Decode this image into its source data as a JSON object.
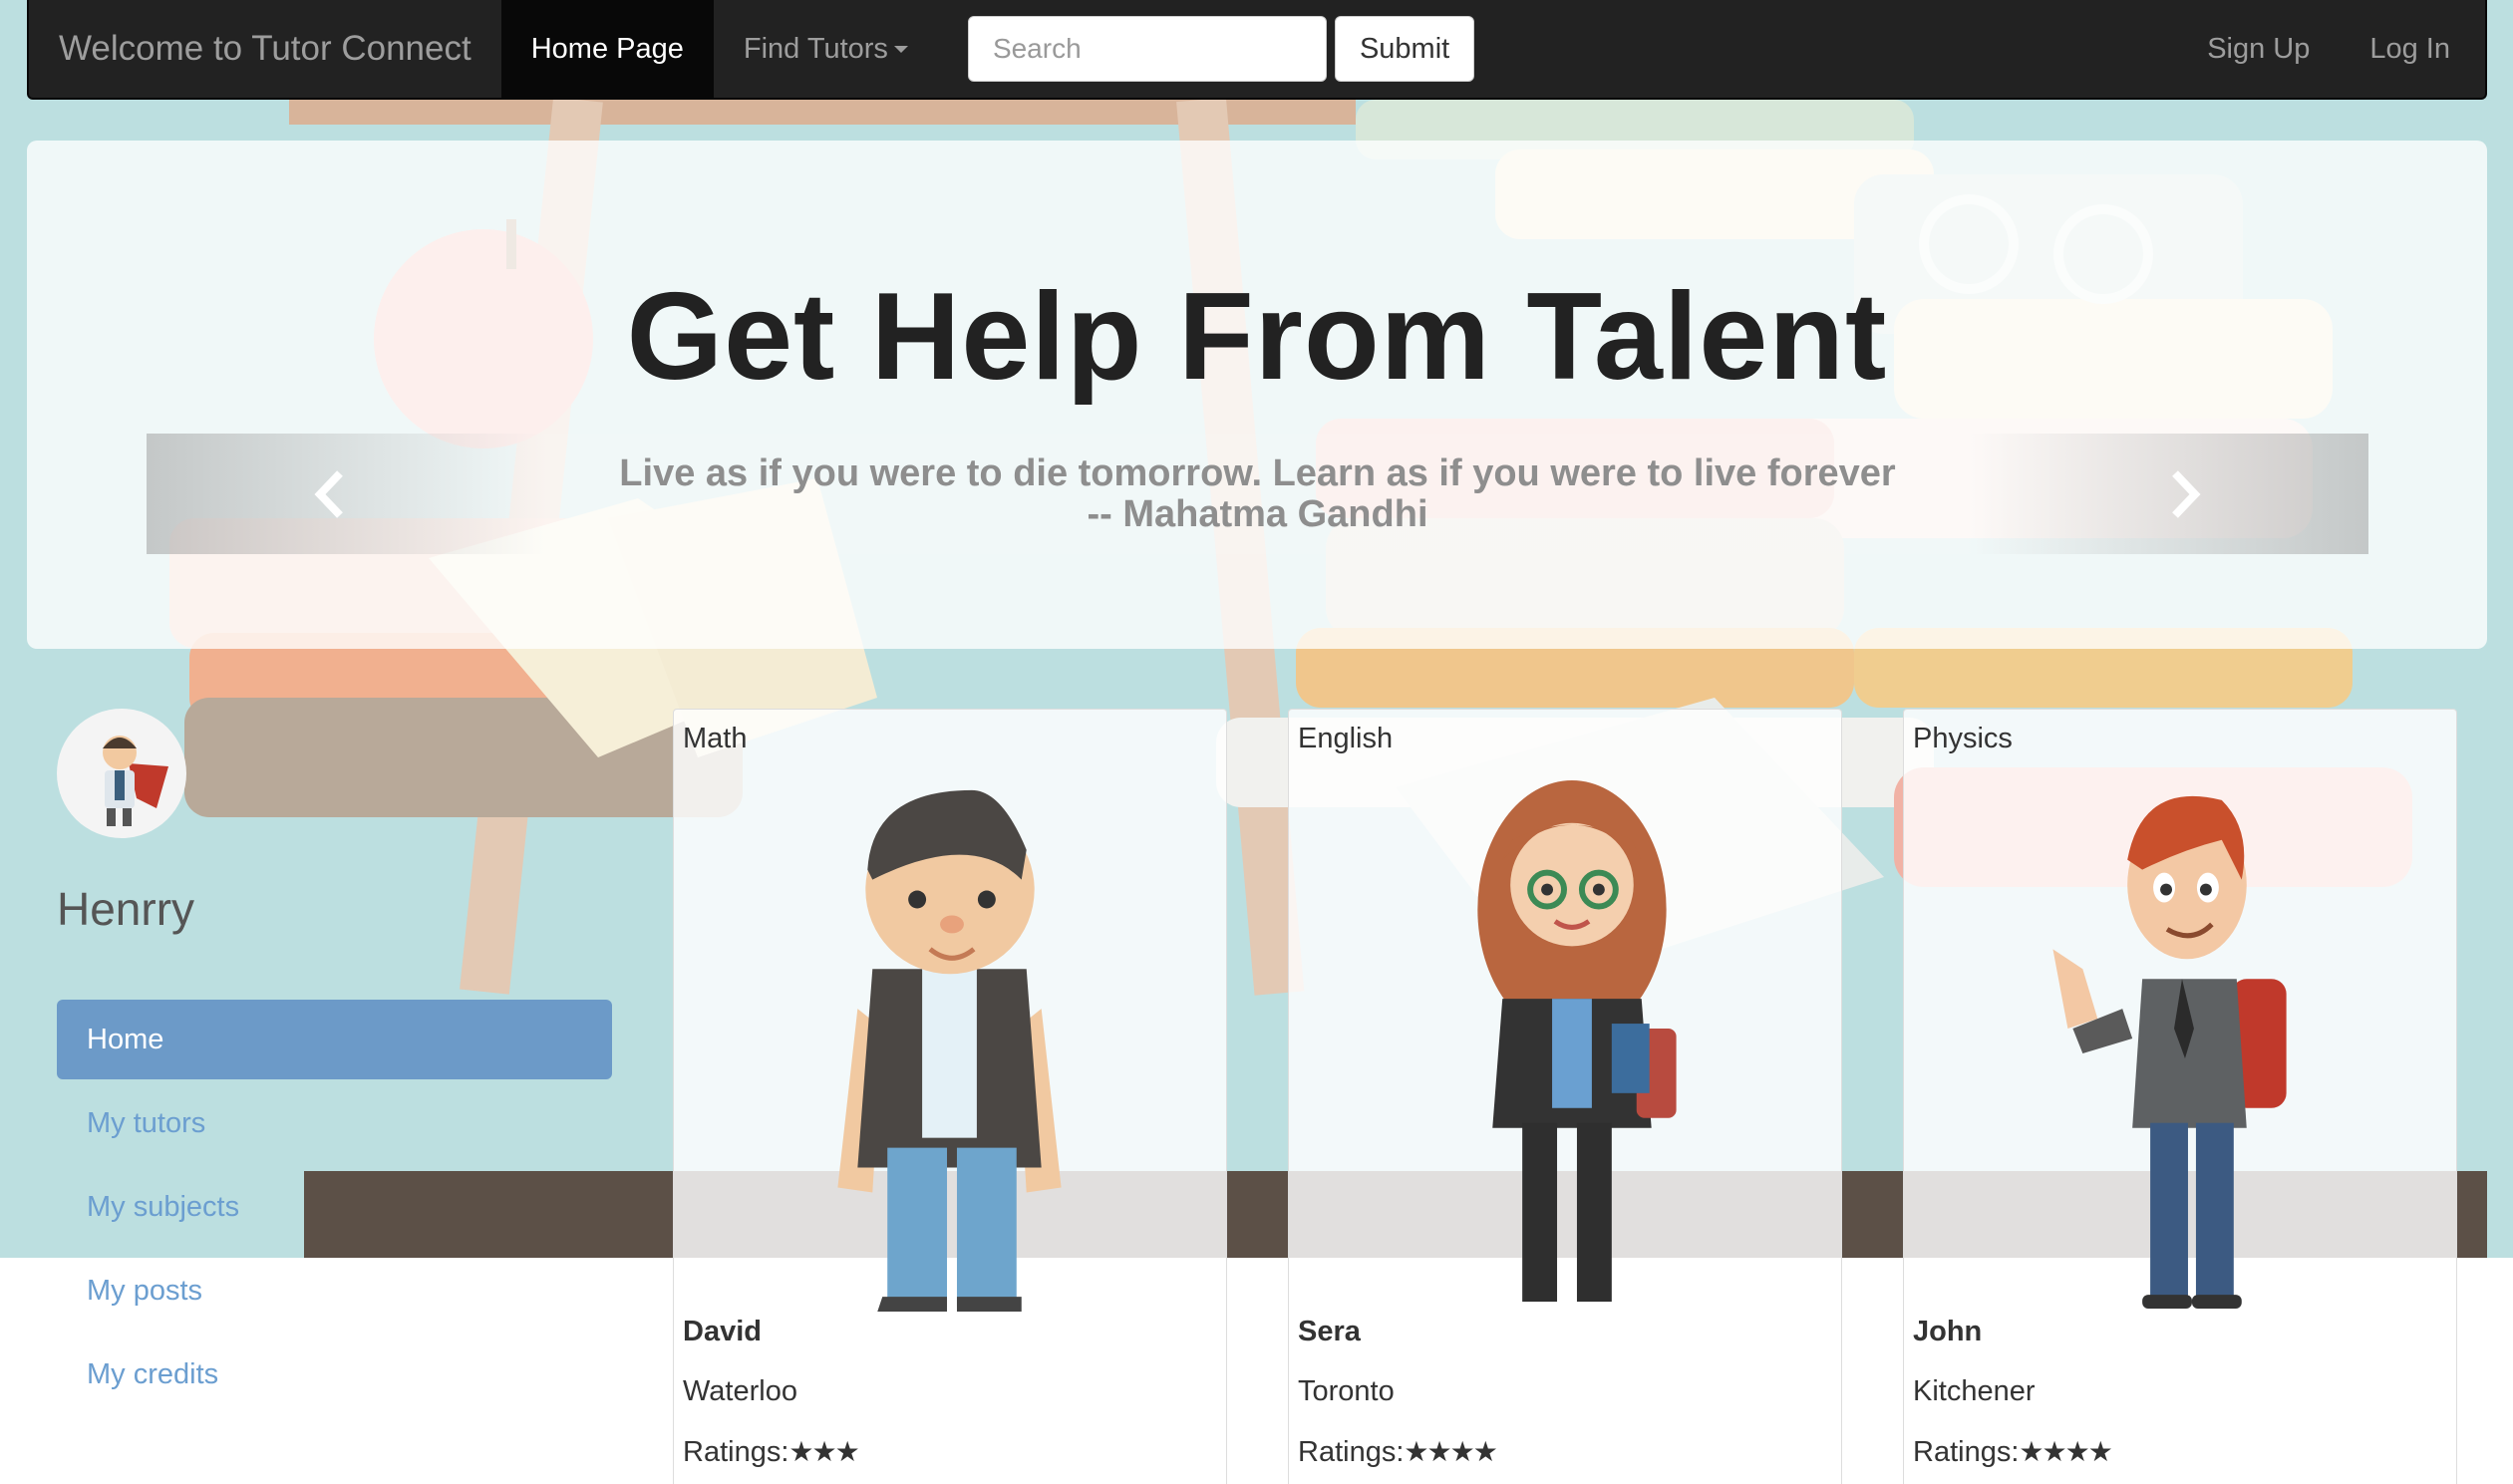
{
  "navbar": {
    "brand": "Welcome to Tutor Connect",
    "home_label": "Home Page",
    "find_tutors_label": "Find Tutors",
    "search_placeholder": "Search",
    "submit_label": "Submit",
    "signup_label": "Sign Up",
    "login_label": "Log In"
  },
  "hero": {
    "title": "Get Help From Talent",
    "quote_line1": "Live as if you were to die tomorrow. Learn as if you were to live forever",
    "quote_line2": "-- Mahatma Gandhi"
  },
  "profile": {
    "name": "Henrry",
    "nav": [
      {
        "label": "Home",
        "active": true
      },
      {
        "label": "My tutors",
        "active": false
      },
      {
        "label": "My subjects",
        "active": false
      },
      {
        "label": "My posts",
        "active": false
      },
      {
        "label": "My credits",
        "active": false
      }
    ]
  },
  "tutors": [
    {
      "subject": "Math",
      "name": "David",
      "city": "Waterloo",
      "ratings_label": "Ratings:",
      "stars": 3
    },
    {
      "subject": "English",
      "name": "Sera",
      "city": "Toronto",
      "ratings_label": "Ratings:",
      "stars": 4
    },
    {
      "subject": "Physics",
      "name": "John",
      "city": "Kitchener",
      "ratings_label": "Ratings:",
      "stars": 4
    }
  ],
  "colors": {
    "navbar_bg": "#222222",
    "active_nav": "#080808",
    "sidebar_active": "#6c9ac8",
    "sidebar_link": "#6b9ed0",
    "page_bg": "#bcdfe0"
  }
}
